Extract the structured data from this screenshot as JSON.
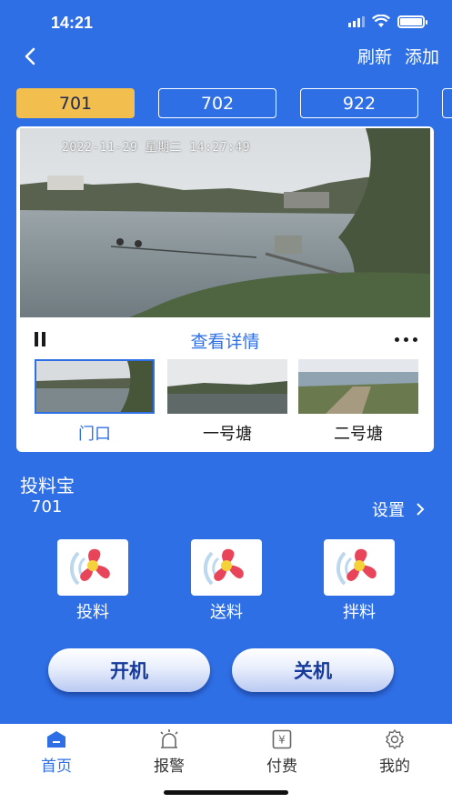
{
  "status_bar": {
    "time": "14:21"
  },
  "header": {
    "refresh_label": "刷新",
    "add_label": "添加"
  },
  "device_tabs": [
    {
      "label": "701",
      "active": true
    },
    {
      "label": "702",
      "active": false
    },
    {
      "label": "922",
      "active": false
    }
  ],
  "camera": {
    "timestamp": "2022-11-29 星期二 14:27:49",
    "detail_link": "查看详情",
    "thumbnails": [
      {
        "label": "门口",
        "selected": true
      },
      {
        "label": "一号塘",
        "selected": false
      },
      {
        "label": "二号塘",
        "selected": false
      }
    ]
  },
  "feeder": {
    "title": "投料宝",
    "device_id": "701",
    "settings_label": "设置",
    "features": [
      {
        "label": "投料",
        "icon": "fan-icon"
      },
      {
        "label": "送料",
        "icon": "fan-icon"
      },
      {
        "label": "拌料",
        "icon": "fan-icon"
      }
    ],
    "power_on_label": "开机",
    "power_off_label": "关机"
  },
  "bottom_nav": [
    {
      "label": "首页",
      "icon": "home-icon",
      "active": true
    },
    {
      "label": "报警",
      "icon": "alarm-icon",
      "active": false
    },
    {
      "label": "付费",
      "icon": "payment-icon",
      "active": false
    },
    {
      "label": "我的",
      "icon": "settings-gear-icon",
      "active": false
    }
  ],
  "colors": {
    "primary": "#2f6fe6",
    "active_tab": "#f2be4e",
    "fan_red": "#e8445a",
    "fan_yellow": "#f5d23a"
  }
}
